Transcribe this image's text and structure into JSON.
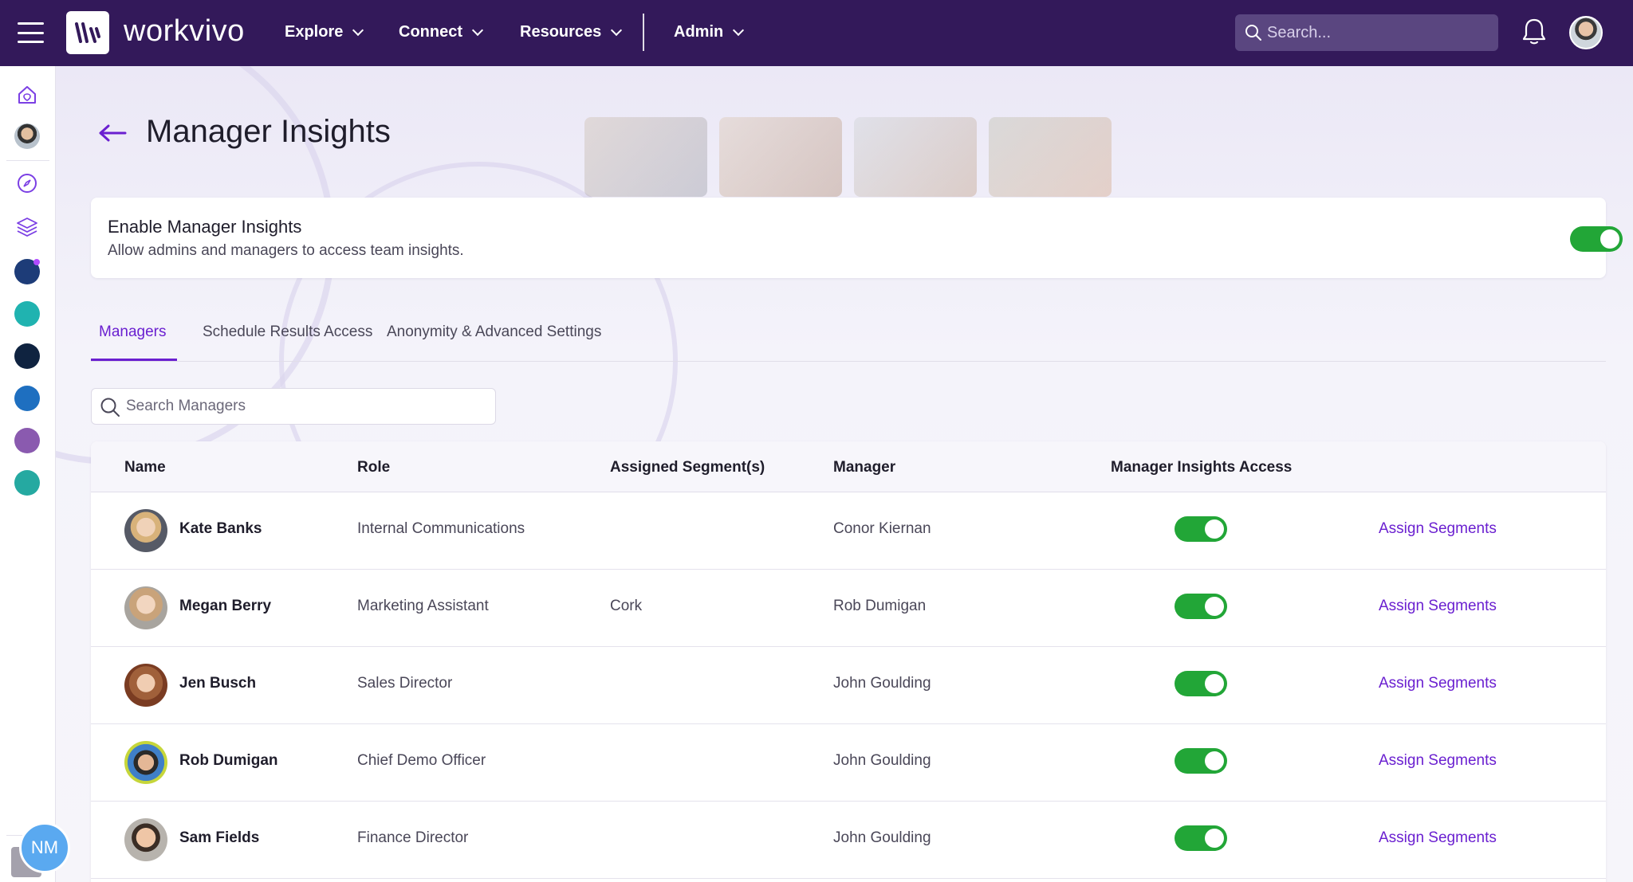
{
  "header": {
    "brand": "workvivo",
    "nav": [
      {
        "label": "Explore"
      },
      {
        "label": "Connect"
      },
      {
        "label": "Resources"
      },
      {
        "label": "Admin"
      }
    ],
    "search_placeholder": "Search..."
  },
  "page": {
    "title": "Manager Insights"
  },
  "enable": {
    "title": "Enable Manager Insights",
    "subtitle": "Allow admins and managers to access team insights.",
    "enabled": true
  },
  "tabs": [
    {
      "label": "Managers",
      "active": true
    },
    {
      "label": "Schedule Results Access",
      "active": false
    },
    {
      "label": "Anonymity & Advanced Settings",
      "active": false
    }
  ],
  "manager_search": {
    "placeholder": "Search Managers"
  },
  "table": {
    "columns": [
      "Name",
      "Role",
      "Assigned Segment(s)",
      "Manager",
      "Manager Insights Access"
    ],
    "action_label": "Assign Segments",
    "rows": [
      {
        "name": "Kate Banks",
        "role": "Internal Communications",
        "segment": "",
        "manager": "Conor Kiernan",
        "access": true
      },
      {
        "name": "Megan Berry",
        "role": "Marketing Assistant",
        "segment": "Cork",
        "manager": "Rob Dumigan",
        "access": true
      },
      {
        "name": "Jen Busch",
        "role": "Sales Director",
        "segment": "",
        "manager": "John Goulding",
        "access": true
      },
      {
        "name": "Rob Dumigan",
        "role": "Chief Demo Officer",
        "segment": "",
        "manager": "John Goulding",
        "access": true
      },
      {
        "name": "Sam Fields",
        "role": "Finance Director",
        "segment": "",
        "manager": "John Goulding",
        "access": true
      }
    ]
  },
  "user_badge": "NM",
  "colors": {
    "topbar": "#33195a",
    "accent": "#6a1fd0",
    "toggle_on": "#22a637"
  }
}
